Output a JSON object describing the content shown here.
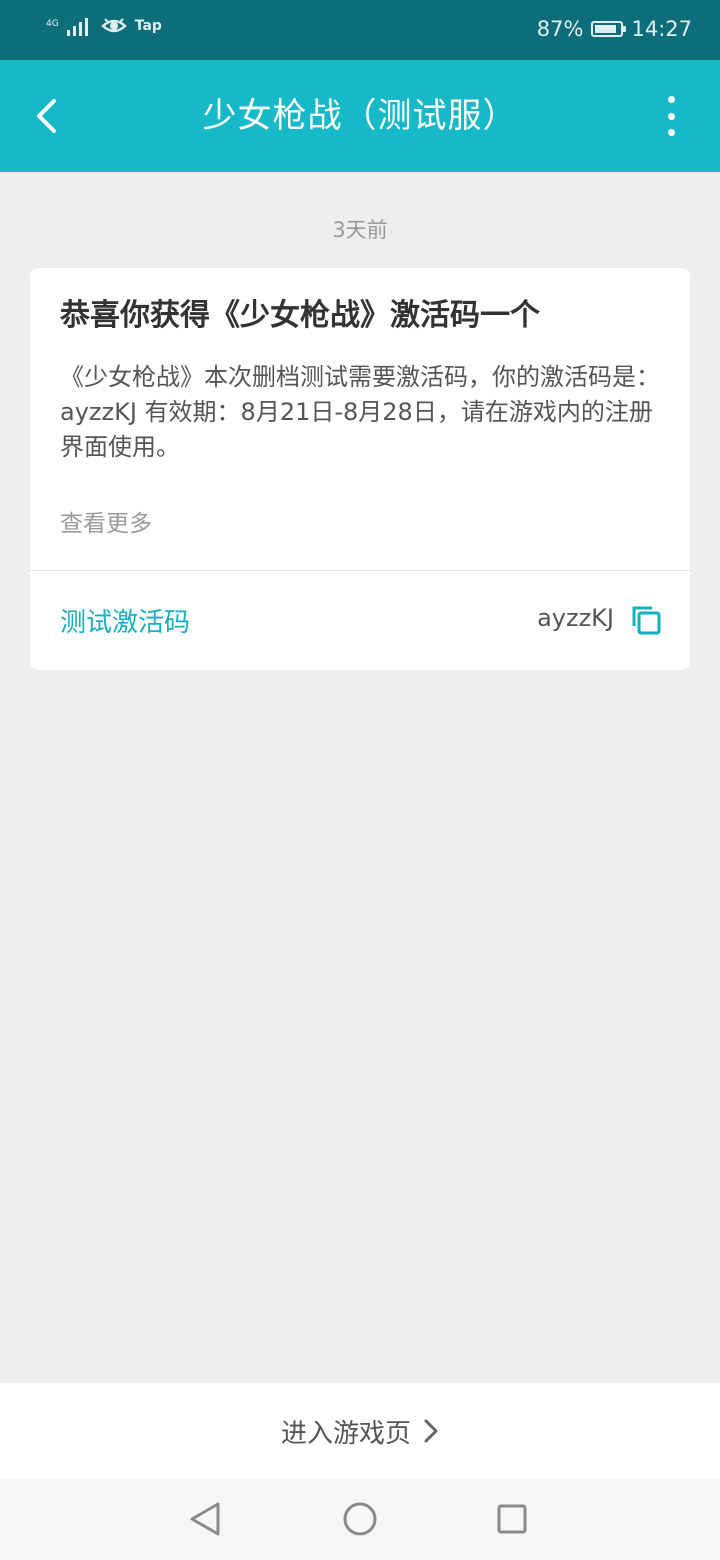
{
  "status_bar": {
    "signal_label": "4G",
    "app_badge": "Tap",
    "battery_percent": "87%",
    "battery_level": 0.87,
    "time": "14:27"
  },
  "app_bar": {
    "title": "少女枪战（测试服）",
    "back_icon": "chevron-left-icon",
    "more_icon": "more-vertical-icon"
  },
  "message": {
    "timestamp": "3天前",
    "title": "恭喜你获得《少女枪战》激活码一个",
    "body": "《少女枪战》本次删档测试需要激活码，你的激活码是：ayzzKJ 有效期：8月21日-8月28日，请在游戏内的注册界面使用。",
    "view_more": "查看更多",
    "code_label": "测试激活码",
    "code_value": "ayzzKJ",
    "copy_icon": "copy-icon"
  },
  "bottom_action": {
    "label": "进入游戏页",
    "icon": "chevron-right-icon"
  },
  "colors": {
    "status_bar": "#0d6e7a",
    "app_bar": "#15b9c7",
    "accent": "#15b0c0",
    "background": "#eeeeee"
  }
}
